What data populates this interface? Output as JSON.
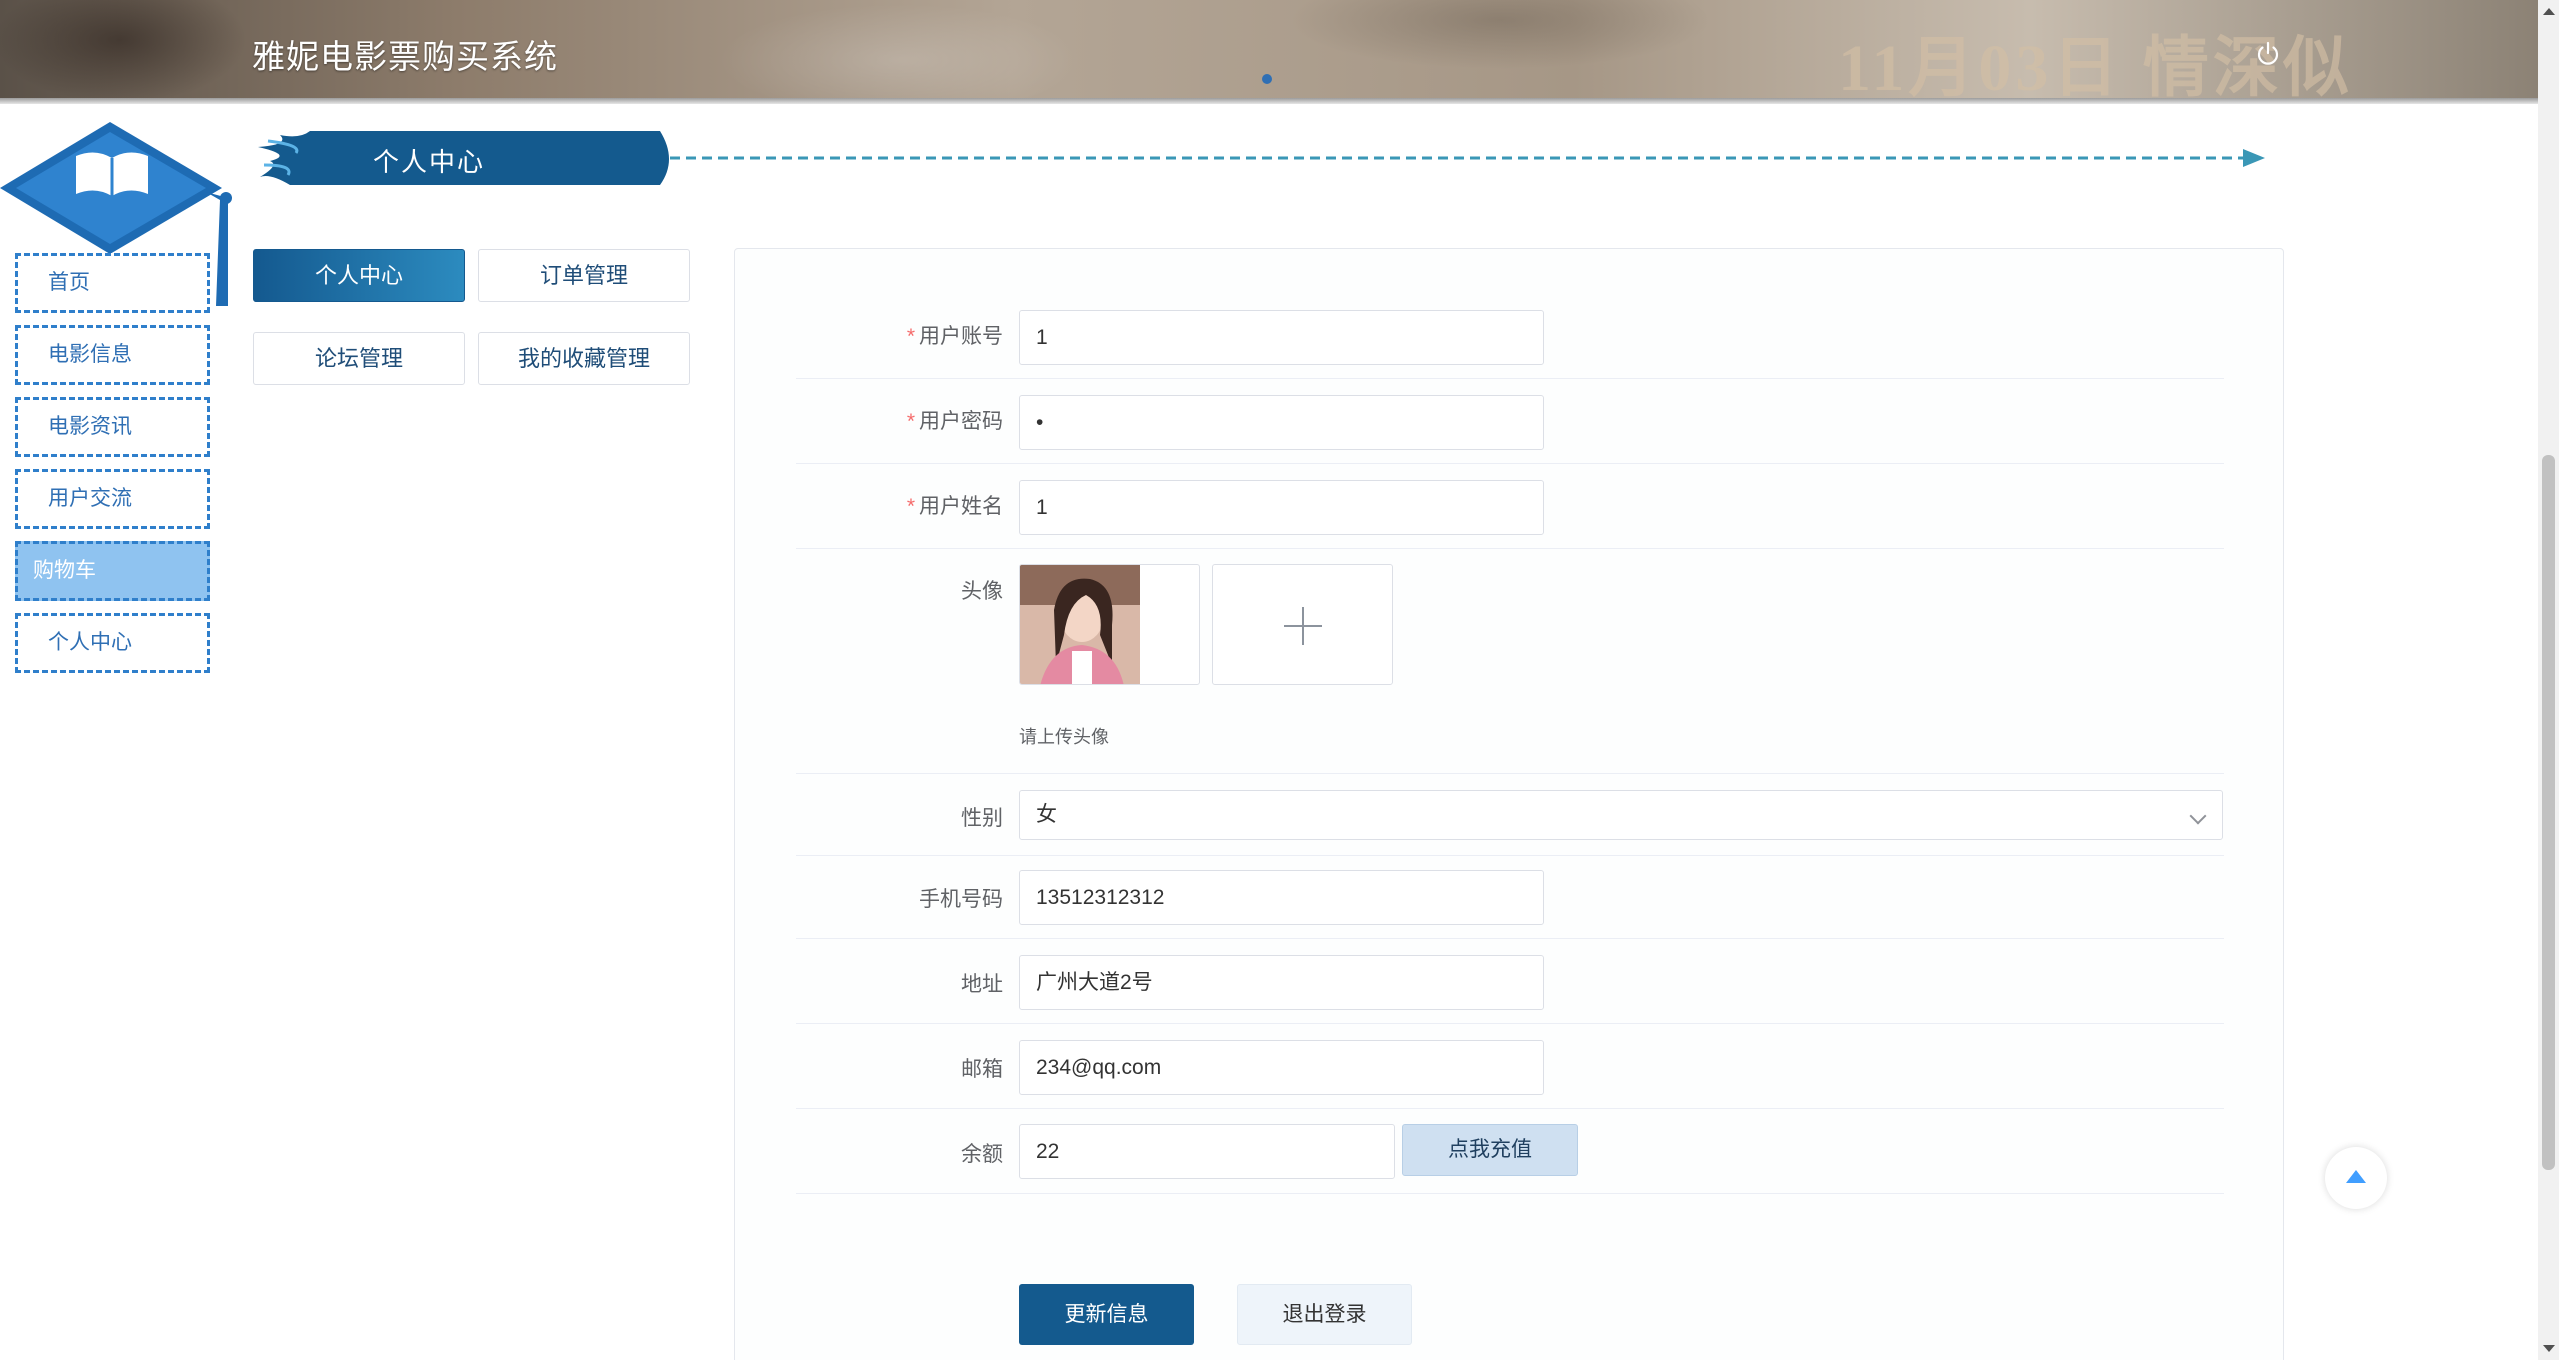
{
  "header": {
    "title": "雅妮电影票购买系统",
    "banner_text": "11月03日 情深似"
  },
  "nav": {
    "items": [
      {
        "label": "首页",
        "active": false
      },
      {
        "label": "电影信息",
        "active": false
      },
      {
        "label": "电影资讯",
        "active": false
      },
      {
        "label": "用户交流",
        "active": false
      },
      {
        "label": "购物车",
        "active": true
      },
      {
        "label": "个人中心",
        "active": false
      }
    ]
  },
  "section": {
    "title": "个人中心"
  },
  "tabs": [
    {
      "label": "个人中心",
      "active": true
    },
    {
      "label": "订单管理",
      "active": false
    },
    {
      "label": "论坛管理",
      "active": false
    },
    {
      "label": "我的收藏管理",
      "active": false
    }
  ],
  "form": {
    "account": {
      "label": "用户账号",
      "required": true,
      "value": "1"
    },
    "password": {
      "label": "用户密码",
      "required": true,
      "value": "•"
    },
    "name": {
      "label": "用户姓名",
      "required": true,
      "value": "1"
    },
    "avatar": {
      "label": "头像",
      "hint": "请上传头像"
    },
    "gender": {
      "label": "性别",
      "value": "女"
    },
    "phone": {
      "label": "手机号码",
      "value": "13512312312"
    },
    "address": {
      "label": "地址",
      "value": "广州大道2号"
    },
    "email": {
      "label": "邮箱",
      "value": "234@qq.com"
    },
    "balance": {
      "label": "余额",
      "value": "22",
      "recharge_label": "点我充值"
    },
    "required_mark": "*"
  },
  "actions": {
    "update_label": "更新信息",
    "logout_label": "退出登录"
  },
  "colors": {
    "primary": "#145a8e",
    "nav_border": "#2f7fcb",
    "nav_active_bg": "#8fc3f0",
    "required": "#f56c6c"
  },
  "icons": [
    "power-icon",
    "open-book-icon",
    "plus-icon",
    "chevron-down-icon",
    "back-to-top-icon"
  ]
}
